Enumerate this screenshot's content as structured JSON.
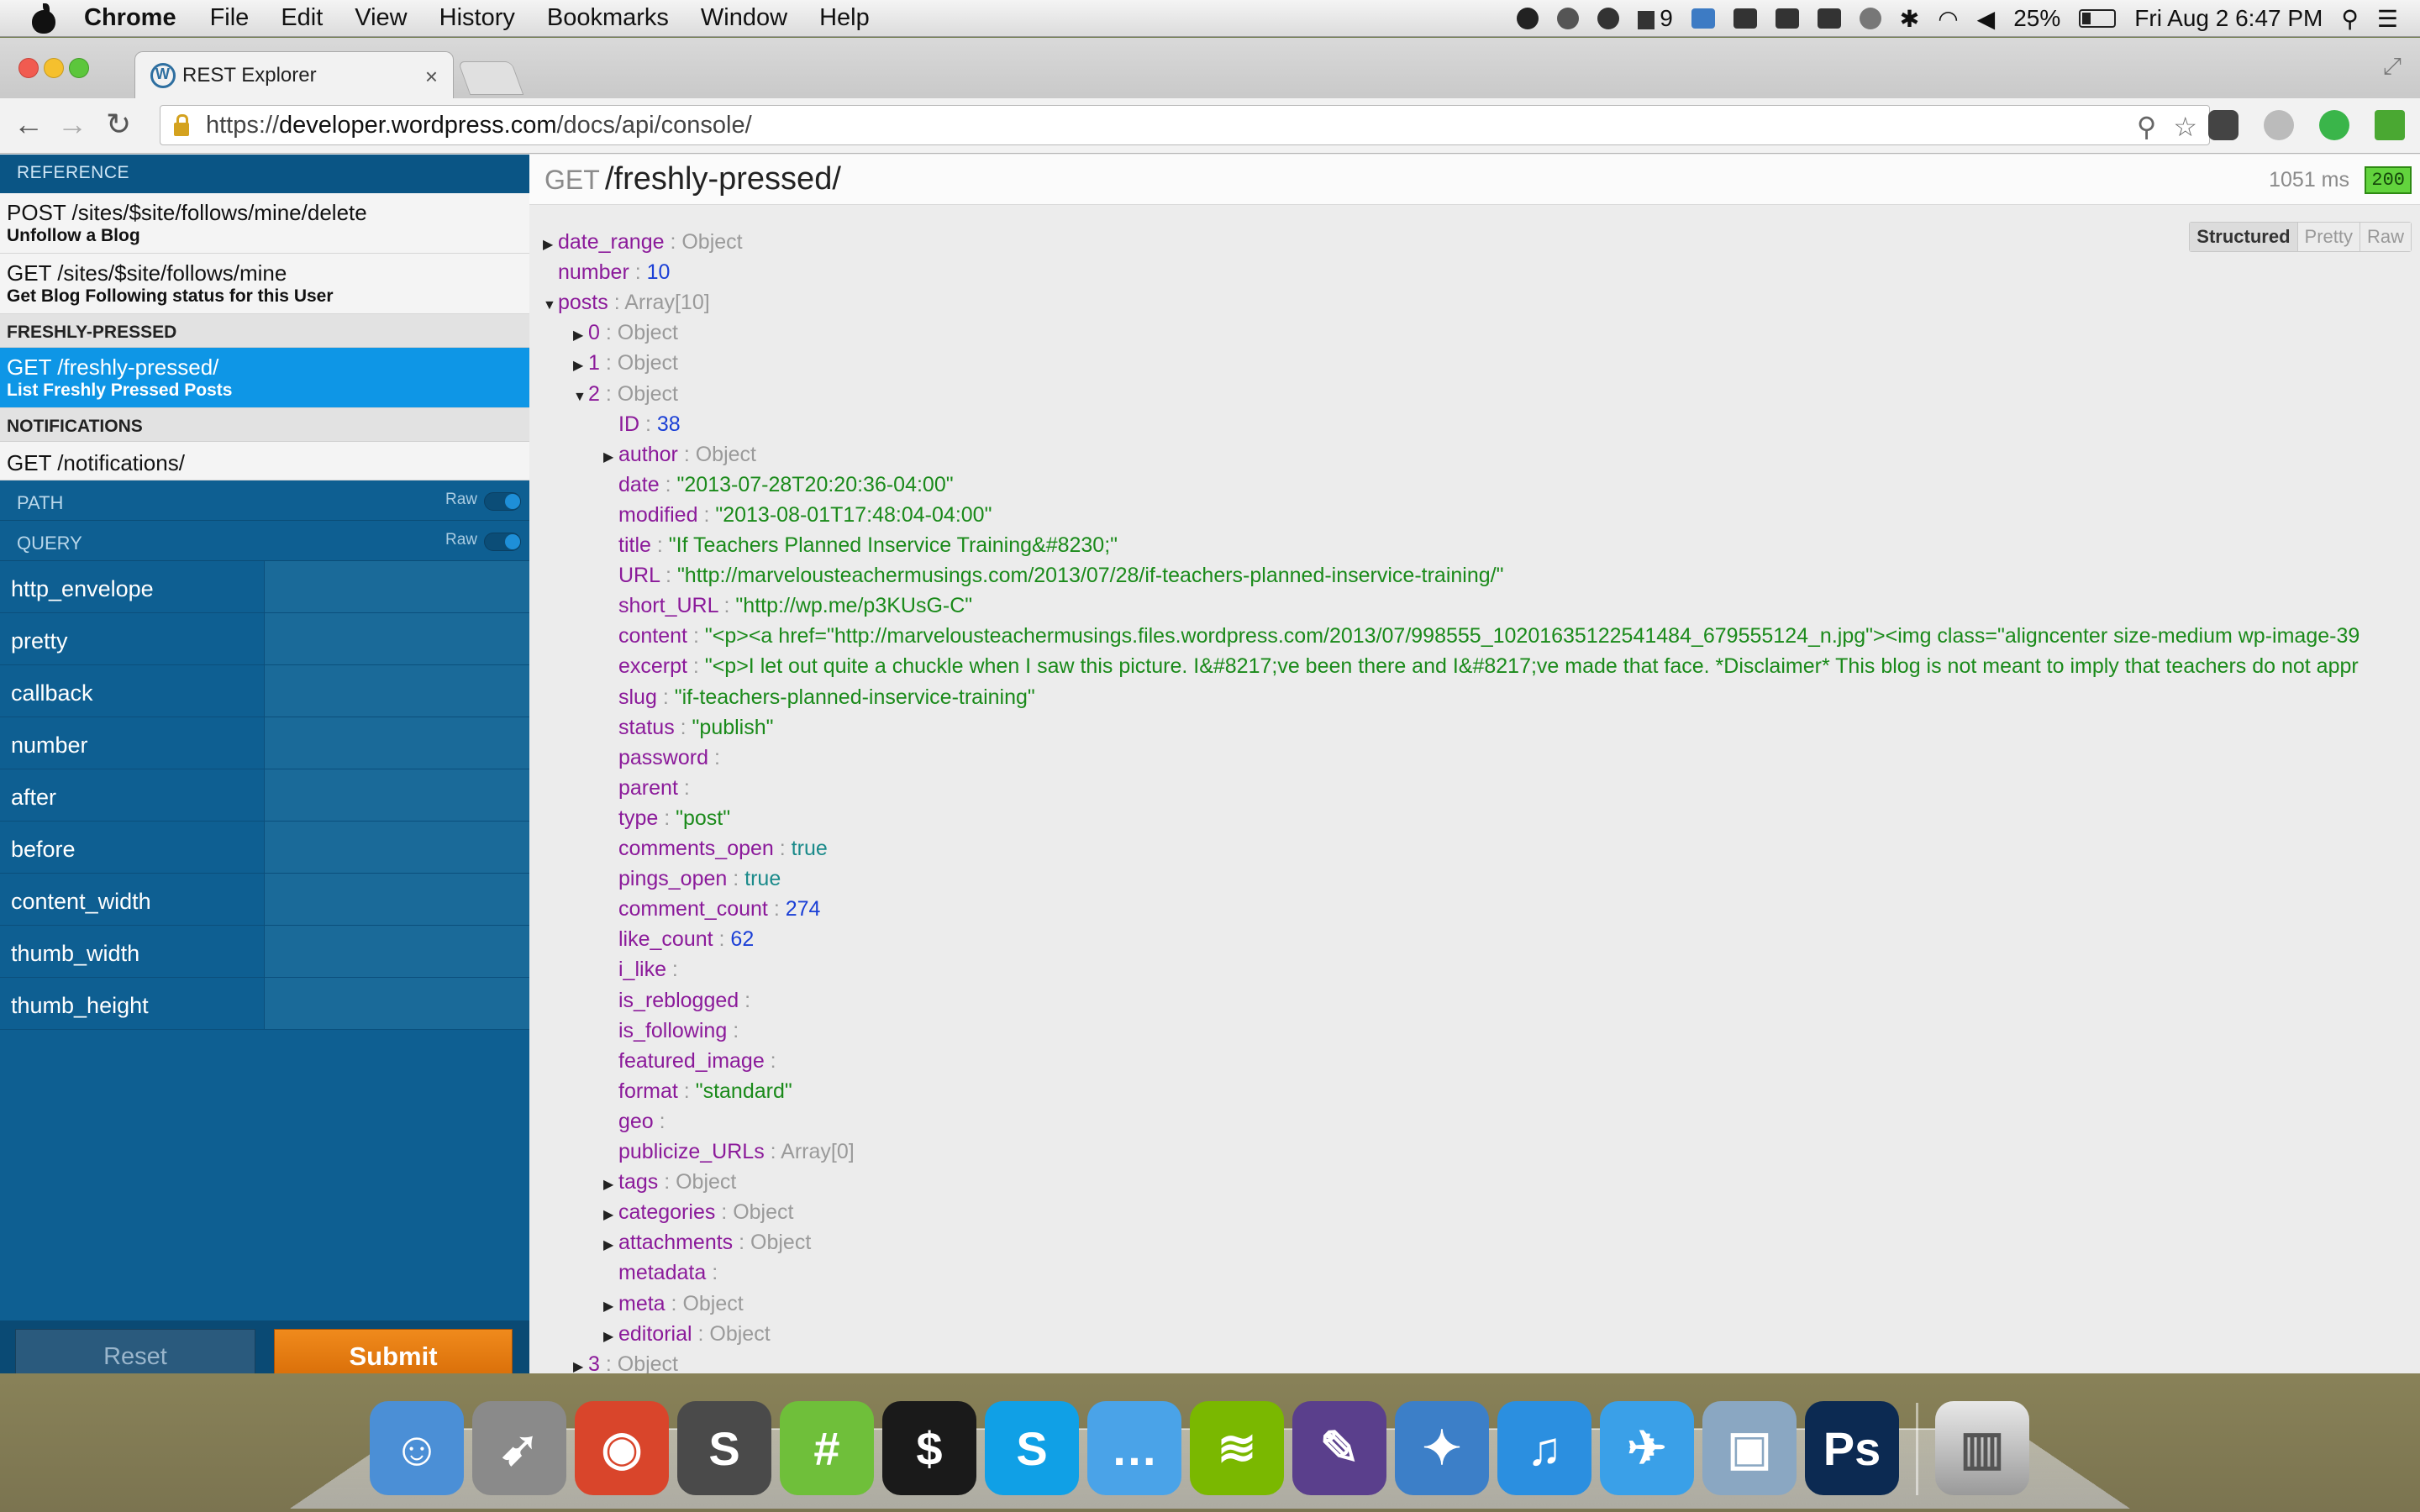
{
  "menubar": {
    "app_name": "Chrome",
    "menus": [
      "File",
      "Edit",
      "View",
      "History",
      "Bookmarks",
      "Window",
      "Help"
    ],
    "status": {
      "notification_count": "9",
      "battery": "25%",
      "clock": "Fri Aug 2  6:47 PM"
    }
  },
  "browser": {
    "tab_title": "REST Explorer",
    "url_scheme": "https://",
    "url_host": "developer.wordpress.com",
    "url_path": "/docs/api/console/"
  },
  "sidebar": {
    "reference_header": "REFERENCE",
    "endpoints_top": [
      {
        "path": "POST /sites/$site/follows/mine/delete",
        "desc": "Unfollow a Blog"
      },
      {
        "path": "GET /sites/$site/follows/mine",
        "desc": "Get Blog Following status for this User"
      }
    ],
    "cat_freshly": "FRESHLY-PRESSED",
    "active_endpoint": {
      "path": "GET /freshly-pressed/",
      "desc": "List Freshly Pressed Posts"
    },
    "cat_notifications": "NOTIFICATIONS",
    "notifications_endpoint": "GET /notifications/",
    "path_section": "PATH",
    "query_section": "QUERY",
    "raw_label": "Raw",
    "query_params": [
      "http_envelope",
      "pretty",
      "callback",
      "number",
      "after",
      "before",
      "content_width",
      "thumb_width",
      "thumb_height"
    ],
    "reset_label": "Reset",
    "submit_label": "Submit"
  },
  "response": {
    "method": "GET",
    "path": "/freshly-pressed/",
    "timing": "1051 ms",
    "status_code": "200",
    "views": [
      "Structured",
      "Pretty",
      "Raw"
    ],
    "active_view": "Structured"
  },
  "tree": [
    {
      "depth": 0,
      "arrow": "right",
      "key": "date_range",
      "type": "Object"
    },
    {
      "depth": 0,
      "arrow": "none",
      "key": "number",
      "num": "10"
    },
    {
      "depth": 0,
      "arrow": "down",
      "key": "posts",
      "type": "Array[10]"
    },
    {
      "depth": 1,
      "arrow": "right",
      "key": "0",
      "type": "Object"
    },
    {
      "depth": 1,
      "arrow": "right",
      "key": "1",
      "type": "Object"
    },
    {
      "depth": 1,
      "arrow": "down",
      "key": "2",
      "type": "Object"
    },
    {
      "depth": 2,
      "arrow": "none",
      "key": "ID",
      "num": "38"
    },
    {
      "depth": 2,
      "arrow": "right",
      "key": "author",
      "type": "Object"
    },
    {
      "depth": 2,
      "arrow": "none",
      "key": "date",
      "str": "\"2013-07-28T20:20:36-04:00\""
    },
    {
      "depth": 2,
      "arrow": "none",
      "key": "modified",
      "str": "\"2013-08-01T17:48:04-04:00\""
    },
    {
      "depth": 2,
      "arrow": "none",
      "key": "title",
      "str": "\"If Teachers Planned Inservice Training&#8230;\""
    },
    {
      "depth": 2,
      "arrow": "none",
      "key": "URL",
      "str": "\"http://marvelousteachermusings.com/2013/07/28/if-teachers-planned-inservice-training/\""
    },
    {
      "depth": 2,
      "arrow": "none",
      "key": "short_URL",
      "str": "\"http://wp.me/p3KUsG-C\""
    },
    {
      "depth": 2,
      "arrow": "none",
      "key": "content",
      "str": "\"<p><a href=\"http://marvelousteachermusings.files.wordpress.com/2013/07/998555_10201635122541484_679555124_n.jpg\"><img class=\"aligncenter size-medium wp-image-39"
    },
    {
      "depth": 2,
      "arrow": "none",
      "key": "excerpt",
      "str": "\"<p>I let out quite a chuckle when I saw this picture. I&#8217;ve been there and I&#8217;ve made that face. *Disclaimer* This blog is not meant to imply that teachers do not appr"
    },
    {
      "depth": 2,
      "arrow": "none",
      "key": "slug",
      "str": "\"if-teachers-planned-inservice-training\""
    },
    {
      "depth": 2,
      "arrow": "none",
      "key": "status",
      "str": "\"publish\""
    },
    {
      "depth": 2,
      "arrow": "none",
      "key": "password"
    },
    {
      "depth": 2,
      "arrow": "none",
      "key": "parent"
    },
    {
      "depth": 2,
      "arrow": "none",
      "key": "type",
      "str": "\"post\""
    },
    {
      "depth": 2,
      "arrow": "none",
      "key": "comments_open",
      "bool": "true"
    },
    {
      "depth": 2,
      "arrow": "none",
      "key": "pings_open",
      "bool": "true"
    },
    {
      "depth": 2,
      "arrow": "none",
      "key": "comment_count",
      "num": "274"
    },
    {
      "depth": 2,
      "arrow": "none",
      "key": "like_count",
      "num": "62"
    },
    {
      "depth": 2,
      "arrow": "none",
      "key": "i_like"
    },
    {
      "depth": 2,
      "arrow": "none",
      "key": "is_reblogged"
    },
    {
      "depth": 2,
      "arrow": "none",
      "key": "is_following"
    },
    {
      "depth": 2,
      "arrow": "none",
      "key": "featured_image"
    },
    {
      "depth": 2,
      "arrow": "none",
      "key": "format",
      "str": "\"standard\""
    },
    {
      "depth": 2,
      "arrow": "none",
      "key": "geo"
    },
    {
      "depth": 2,
      "arrow": "none",
      "key": "publicize_URLs",
      "type": "Array[0]"
    },
    {
      "depth": 2,
      "arrow": "right",
      "key": "tags",
      "type": "Object"
    },
    {
      "depth": 2,
      "arrow": "right",
      "key": "categories",
      "type": "Object"
    },
    {
      "depth": 2,
      "arrow": "right",
      "key": "attachments",
      "type": "Object"
    },
    {
      "depth": 2,
      "arrow": "none",
      "key": "metadata"
    },
    {
      "depth": 2,
      "arrow": "right",
      "key": "meta",
      "type": "Object"
    },
    {
      "depth": 2,
      "arrow": "right",
      "key": "editorial",
      "type": "Object"
    },
    {
      "depth": 1,
      "arrow": "right",
      "key": "3",
      "type": "Object"
    }
  ],
  "dock": {
    "apps": [
      {
        "name": "finder-icon",
        "color": "#4b8fd6",
        "glyph": "☺"
      },
      {
        "name": "launchpad-icon",
        "color": "#8a8a8a",
        "glyph": "➹"
      },
      {
        "name": "chrome-icon",
        "color": "#d9452b",
        "glyph": "◉"
      },
      {
        "name": "sublime-text-icon",
        "color": "#4a4a4a",
        "glyph": "S"
      },
      {
        "name": "hashtag-app-icon",
        "color": "#6fbf3a",
        "glyph": "#"
      },
      {
        "name": "terminal-icon",
        "color": "#1a1a1a",
        "glyph": "$"
      },
      {
        "name": "skype-icon",
        "color": "#10a0e6",
        "glyph": "S"
      },
      {
        "name": "messages-icon",
        "color": "#4aa3e8",
        "glyph": "…"
      },
      {
        "name": "spotify-icon",
        "color": "#7ab800",
        "glyph": "≋"
      },
      {
        "name": "quill-app-icon",
        "color": "#5a3f8c",
        "glyph": "✎"
      },
      {
        "name": "safari-like-icon",
        "color": "#3c7fc8",
        "glyph": "✦"
      },
      {
        "name": "itunes-icon",
        "color": "#2b8fe0",
        "glyph": "♫"
      },
      {
        "name": "twitter-icon",
        "color": "#3aa0e8",
        "glyph": "✈"
      },
      {
        "name": "preview-icon",
        "color": "#8aa7c2",
        "glyph": "▣"
      },
      {
        "name": "photoshop-icon",
        "color": "#0c2a52",
        "glyph": "Ps"
      }
    ],
    "trash_name": "trash-icon"
  }
}
